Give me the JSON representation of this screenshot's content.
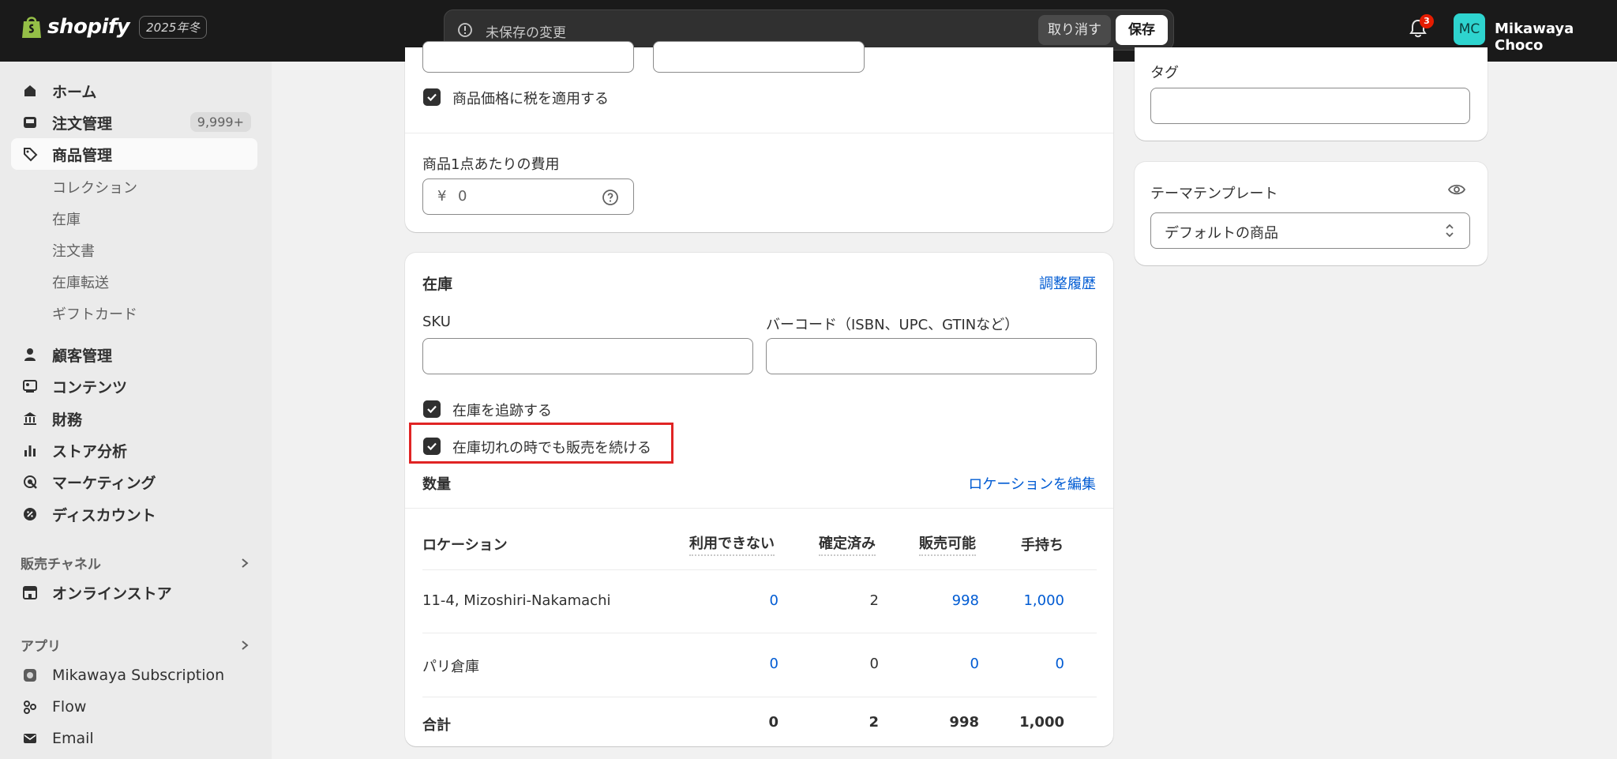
{
  "topbar": {
    "brand": "shopify",
    "edition": "2025年冬",
    "unsaved_message": "未保存の変更",
    "discard_label": "取り消す",
    "save_label": "保存",
    "notifications_count": "3",
    "user_initials": "MC",
    "user_name": "Mikawaya Choco"
  },
  "sidebar": {
    "items": [
      {
        "label": "ホーム",
        "icon": "home-icon"
      },
      {
        "label": "注文管理",
        "icon": "inbox-icon",
        "count": "9,999+"
      },
      {
        "label": "商品管理",
        "icon": "tag-icon",
        "active": true
      },
      {
        "label": "顧客管理",
        "icon": "person-icon"
      },
      {
        "label": "コンテンツ",
        "icon": "image-icon"
      },
      {
        "label": "財務",
        "icon": "bank-icon"
      },
      {
        "label": "ストア分析",
        "icon": "bar-chart-icon"
      },
      {
        "label": "マーケティング",
        "icon": "target-icon"
      },
      {
        "label": "ディスカウント",
        "icon": "discount-icon"
      }
    ],
    "product_subitems": [
      "コレクション",
      "在庫",
      "注文書",
      "在庫転送",
      "ギフトカード"
    ],
    "sales_channels_heading": "販売チャネル",
    "sales_channels": [
      {
        "label": "オンラインストア",
        "icon": "store-icon"
      }
    ],
    "apps_heading": "アプリ",
    "apps": [
      {
        "label": "Mikawaya Subscription",
        "icon": "app-icon"
      },
      {
        "label": "Flow",
        "icon": "flow-icon"
      },
      {
        "label": "Email",
        "icon": "email-icon"
      }
    ]
  },
  "pricing": {
    "charge_tax_label": "商品価格に税を適用する",
    "cost_label": "商品1点あたりの費用",
    "cost_currency": "¥",
    "cost_value": "0"
  },
  "inventory": {
    "title": "在庫",
    "history_link": "調整履歴",
    "sku_label": "SKU",
    "sku_value": "",
    "barcode_label": "バーコード（ISBN、UPC、GTINなど）",
    "barcode_value": "",
    "track_label": "在庫を追跡する",
    "continue_selling_label": "在庫切れの時でも販売を続ける",
    "quantity_heading": "数量",
    "edit_locations_link": "ロケーションを編集",
    "columns": [
      "ロケーション",
      "利用できない",
      "確定済み",
      "販売可能",
      "手持ち"
    ],
    "rows": [
      {
        "location": "11-4, Mizoshiri-Nakamachi",
        "unavailable": "0",
        "committed": "2",
        "available": "998",
        "on_hand": "1,000"
      },
      {
        "location": "パリ倉庫",
        "unavailable": "0",
        "committed": "0",
        "available": "0",
        "on_hand": "0"
      }
    ],
    "total": {
      "location": "合計",
      "unavailable": "0",
      "committed": "2",
      "available": "998",
      "on_hand": "1,000"
    }
  },
  "organization": {
    "tags_label": "タグ",
    "tags_value": ""
  },
  "theme": {
    "template_label": "テーマテンプレート",
    "template_value": "デフォルトの商品"
  },
  "colors": {
    "accent_link": "#005bd3",
    "highlight_box": "#e02424",
    "topbar_bg": "#1a1a1a"
  }
}
